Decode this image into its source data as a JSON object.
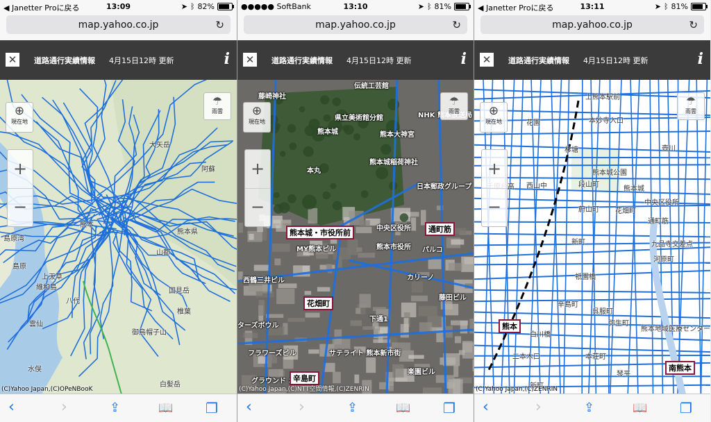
{
  "screens": [
    {
      "status": {
        "left": "◀ Janetter Proに戻る",
        "time": "13:09",
        "battery": "82%",
        "battery_level": 0.82
      },
      "url": "map.yahoo.co.jp",
      "info": {
        "title": "道路通行実績情報",
        "date": "4月15日12時 更新"
      },
      "map_style": "terrain",
      "controls": {
        "location_label": "現在地",
        "rain_label": "雨雲",
        "zoom_in": "+",
        "zoom_out": "−"
      },
      "labels": [
        "阿蘇",
        "熊本",
        "熊本県",
        "島原湾",
        "島原",
        "上天草",
        "八代",
        "山都",
        "国見岳",
        "椎葉",
        "御鳥帽子山",
        "白髪岳",
        "水俣",
        "雲仙",
        "維和島",
        "大矢岳"
      ],
      "copyright": "(C)Yahoo Japan,(C)OPeNBooK"
    },
    {
      "status": {
        "left": "●●●●● SoftBank",
        "time": "13:10",
        "battery": "81%",
        "battery_level": 0.81
      },
      "url": "map.yahoo.co.jp",
      "info": {
        "title": "道路通行実績情報",
        "date": "4月15日12時 更新"
      },
      "map_style": "satellite",
      "controls": {
        "location_label": "現在地",
        "rain_label": "雨雲",
        "zoom_in": "+",
        "zoom_out": "−"
      },
      "labels": [
        "藤崎神社",
        "伝統工芸館",
        "県立美術館分館",
        "NHK 熊本放送局",
        "熊本城",
        "熊本大神宮",
        "本丸",
        "熊本城稲荷神社",
        "日本郵政グループ 熊本ビル",
        "中央区役所",
        "熊本市役所",
        "MY熊本ビル",
        "パルコ",
        "西鶴三井ビル",
        "カリーノ",
        "藤田ビル",
        "下通1",
        "ターズボウル",
        "フラワーズビル",
        "サテライト 熊本新市街",
        "楽園ビル",
        "グラウンド ボウル"
      ],
      "stations": [
        "熊本城・市役所前",
        "通町筋",
        "花畑町",
        "辛島町"
      ],
      "copyright": "(C)Yahoo Japan,(C)NTT空間情報,(C)ZENRIN"
    },
    {
      "status": {
        "left": "◀ Janetter Proに戻る",
        "time": "13:11",
        "battery": "81%",
        "battery_level": 0.81
      },
      "url": "map.yahoo.co.jp",
      "info": {
        "title": "道路通行実績情報",
        "date": "4月15日12時 更新"
      },
      "map_style": "street",
      "controls": {
        "location_label": "現在地",
        "rain_label": "雨雲",
        "zoom_in": "+",
        "zoom_out": "−"
      },
      "labels": [
        "上熊本駅前",
        "本妙寺入口",
        "花園",
        "杉塘",
        "壺川",
        "熊本城公園",
        "熊本城",
        "段山町",
        "千原台高",
        "西山中",
        "蔚山町",
        "花畑町",
        "中央区役所",
        "通町筋",
        "新町",
        "九品寺交差点",
        "祇園橋",
        "辛島町",
        "呉服町",
        "河原町",
        "弥生町",
        "白川橋",
        "熊本地域医療センター",
        "二本木口",
        "本荘町",
        "新町",
        "琴平",
        "南熊本"
      ],
      "stations": [
        "熊本",
        "南熊本"
      ],
      "copyright": "(C)Yahoo Japan,(C)ZENRIN"
    }
  ],
  "colors": {
    "route_blue": "#1f6fdb",
    "header_bg": "#3b3b3b",
    "ios_blue": "#1a73e8",
    "station_border": "#8a1538"
  }
}
